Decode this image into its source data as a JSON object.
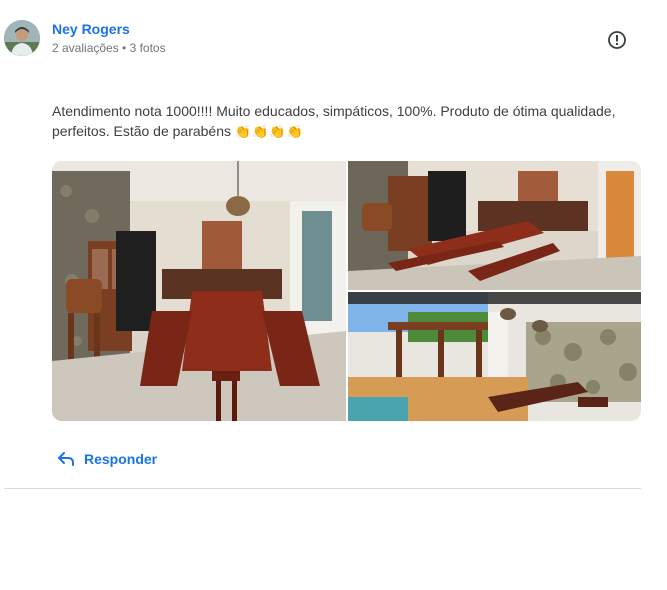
{
  "reviewer": {
    "name": "Ney Rogers",
    "meta": "2 avaliações • 3 fotos"
  },
  "review": {
    "text": "Atendimento nota 1000!!!! Muito educados, simpáticos, 100%. Produto de ótima qualidade, perfeitos. Estão de parabéns",
    "emojis": "👏👏👏👏"
  },
  "photos": [
    {
      "subject": "indoor dining area with red wooden table and benches"
    },
    {
      "subject": "wooden table, benches and cabinet near barbecue"
    },
    {
      "subject": "outdoor pergola with table and decorative wall"
    }
  ],
  "actions": {
    "reply_label": "Responder"
  },
  "icons": {
    "report": "report-icon",
    "reply": "reply-arrow-icon"
  },
  "colors": {
    "link": "#1a73e8",
    "text": "#3c4043",
    "secondary_text": "#70757a",
    "divider": "#dadce0"
  }
}
